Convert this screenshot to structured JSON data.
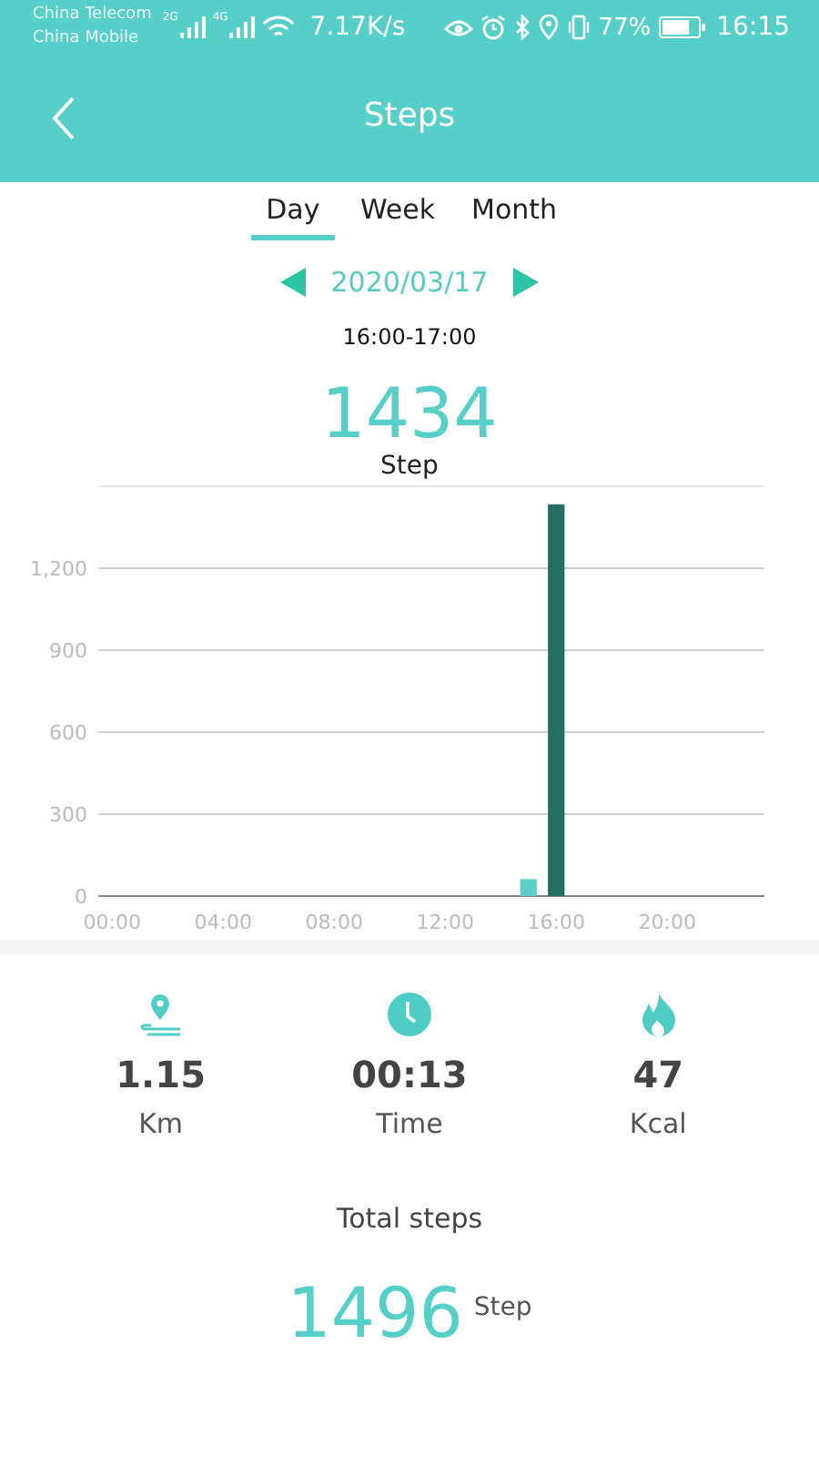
{
  "status_bar": {
    "carriers": [
      "China Telecom",
      "China Mobile"
    ],
    "networks": [
      "2G",
      "4G"
    ],
    "speed": "7.17K/s",
    "battery": "77%",
    "time": "16:15"
  },
  "header": {
    "title": "Steps"
  },
  "tabs": [
    {
      "label": "Day",
      "selected": true
    },
    {
      "label": "Week",
      "selected": false
    },
    {
      "label": "Month",
      "selected": false
    }
  ],
  "date_nav": {
    "date": "2020/03/17"
  },
  "period": "16:00-17:00",
  "selected_steps": {
    "value": "1434",
    "unit": "Step"
  },
  "chart_data": {
    "type": "bar",
    "grid": true,
    "x": [
      0,
      1,
      2,
      3,
      4,
      5,
      6,
      7,
      8,
      9,
      10,
      11,
      12,
      13,
      14,
      15,
      16,
      17,
      18,
      19,
      20,
      21,
      22,
      23
    ],
    "xlim": [
      -0.5,
      23.5
    ],
    "series": [
      {
        "color": "#5ecfc6",
        "values": [
          0,
          0,
          0,
          0,
          0,
          0,
          0,
          0,
          0,
          0,
          0,
          0,
          0,
          0,
          0,
          62,
          0,
          0,
          0,
          0,
          0,
          0,
          0,
          0
        ]
      },
      {
        "color": "#256e66",
        "values": [
          0,
          0,
          0,
          0,
          0,
          0,
          0,
          0,
          0,
          0,
          0,
          0,
          0,
          0,
          0,
          0,
          1434,
          0,
          0,
          0,
          0,
          0,
          0,
          0
        ]
      }
    ],
    "ylim": [
      0,
      1500
    ],
    "yticks": [
      0,
      300,
      600,
      900,
      {
        "value": 1200,
        "label": "1,200"
      }
    ],
    "xticks": [
      {
        "value": 0,
        "label": "00:00"
      },
      {
        "value": 4,
        "label": "04:00"
      },
      {
        "value": 8,
        "label": "08:00"
      },
      {
        "value": 12,
        "label": "12:00"
      },
      {
        "value": 16,
        "label": "16:00"
      },
      {
        "value": 20,
        "label": "20:00"
      }
    ]
  },
  "stats": [
    {
      "kind": "distance",
      "value": "1.15",
      "unit": "Km"
    },
    {
      "kind": "time",
      "value": "00:13",
      "unit": "Time"
    },
    {
      "kind": "calories",
      "value": "47",
      "unit": "Kcal"
    }
  ],
  "total": {
    "label": "Total steps",
    "value": "1496",
    "unit": "Step"
  }
}
